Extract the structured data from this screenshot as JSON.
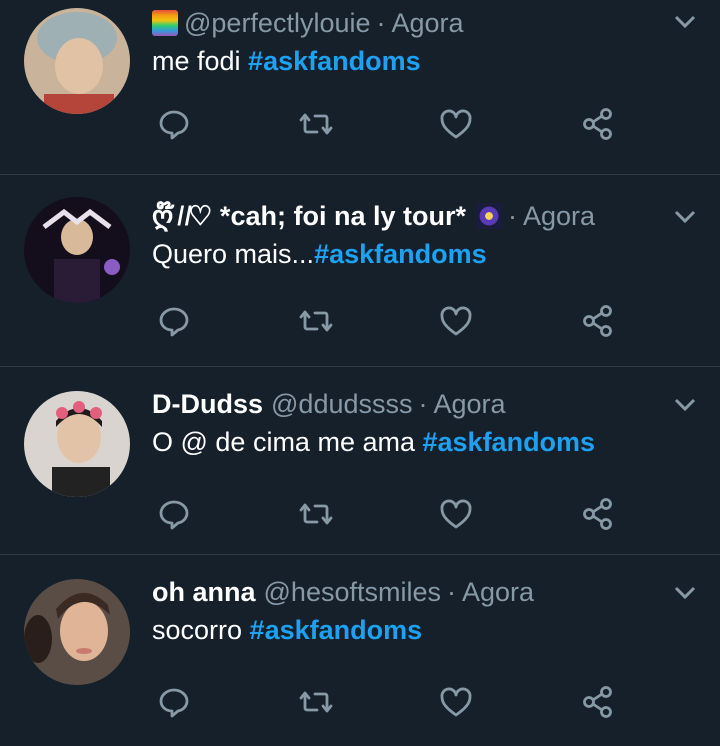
{
  "colors": {
    "background": "#15202b",
    "divider": "#2f3b47",
    "muted": "#8899a6",
    "hashtag": "#1da1f2",
    "text": "#ffffff"
  },
  "tweets": [
    {
      "name": "",
      "handle": "@perfectlylouie",
      "dot": "·",
      "time": "Agora",
      "text": "me fodi ",
      "hashtag": "#askfandoms",
      "emoji": "rainbow-flag-emoji"
    },
    {
      "name": "ღ໊ ̸ ̸♡ *cah; foi na ly tour*",
      "handle": "",
      "dot": "·",
      "time": "Agora",
      "text": "Quero mais...",
      "hashtag": "#askfandoms",
      "emoji": "fireworks-emoji"
    },
    {
      "name": "D-Dudss",
      "handle": "@ddudssss",
      "dot": "·",
      "time": "Agora",
      "text": "O @ de cima me ama ",
      "hashtag": "#askfandoms",
      "emoji": ""
    },
    {
      "name": "oh anna",
      "handle": "@hesoftsmiles",
      "dot": "·",
      "time": "Agora",
      "text": "socorro ",
      "hashtag": "#askfandoms",
      "emoji": ""
    }
  ],
  "actions": [
    "reply-icon",
    "retweet-icon",
    "like-icon",
    "share-icon"
  ]
}
